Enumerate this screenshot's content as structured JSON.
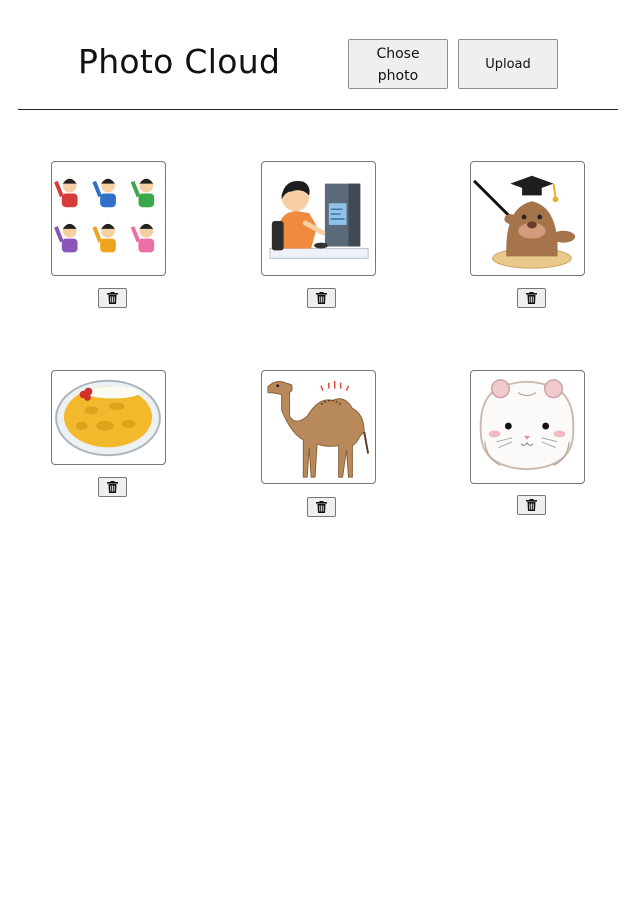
{
  "header": {
    "title": "Photo Cloud",
    "chose_label": "Chose photo",
    "upload_label": "Upload"
  },
  "gallery": {
    "photos": [
      {
        "subject": "group of waving children",
        "delete_icon": "trash-icon"
      },
      {
        "subject": "boy using computer",
        "delete_icon": "trash-icon"
      },
      {
        "subject": "mole teacher with graduation cap",
        "delete_icon": "trash-icon"
      },
      {
        "subject": "plate of curry",
        "delete_icon": "trash-icon"
      },
      {
        "subject": "camel",
        "delete_icon": "trash-icon"
      },
      {
        "subject": "white hamster",
        "delete_icon": "trash-icon"
      }
    ]
  }
}
